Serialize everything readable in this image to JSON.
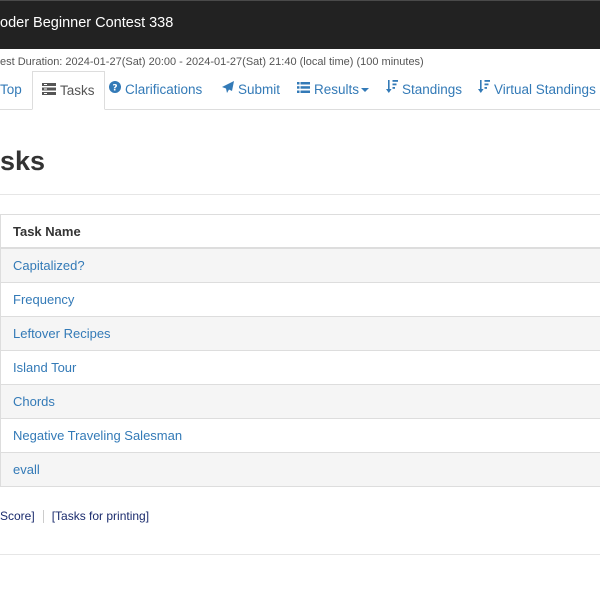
{
  "header": {
    "title": "oder Beginner Contest 338"
  },
  "contest": {
    "duration": "est Duration: 2024-01-27(Sat) 20:00 - 2024-01-27(Sat) 21:40 (local time) (100 minutes)"
  },
  "tabs": [
    {
      "label": "Top",
      "icon": "home-icon",
      "active": false
    },
    {
      "label": "Tasks",
      "icon": "tasks-list-icon",
      "active": true
    },
    {
      "label": "Clarifications",
      "icon": "question-circle-icon",
      "active": false
    },
    {
      "label": "Submit",
      "icon": "paper-plane-icon",
      "active": false
    },
    {
      "label": "Results",
      "icon": "list-icon",
      "active": false
    },
    {
      "label": "Standings",
      "icon": "sort-icon",
      "active": false
    },
    {
      "label": "Virtual Standings",
      "icon": "sort-icon",
      "active": false
    }
  ],
  "page": {
    "heading": "sks"
  },
  "table": {
    "column_header": "Task Name",
    "tasks": [
      "Capitalized?",
      "Frequency",
      "Leftover Recipes",
      "Island Tour",
      "Chords",
      "Negative Traveling Salesman",
      "evall"
    ]
  },
  "footer": {
    "score_link": "Score]",
    "print_link": "[Tasks for printing]"
  },
  "colors": {
    "link": "#337ab7",
    "topbar": "#222222",
    "stripe": "#f5f5f5"
  }
}
